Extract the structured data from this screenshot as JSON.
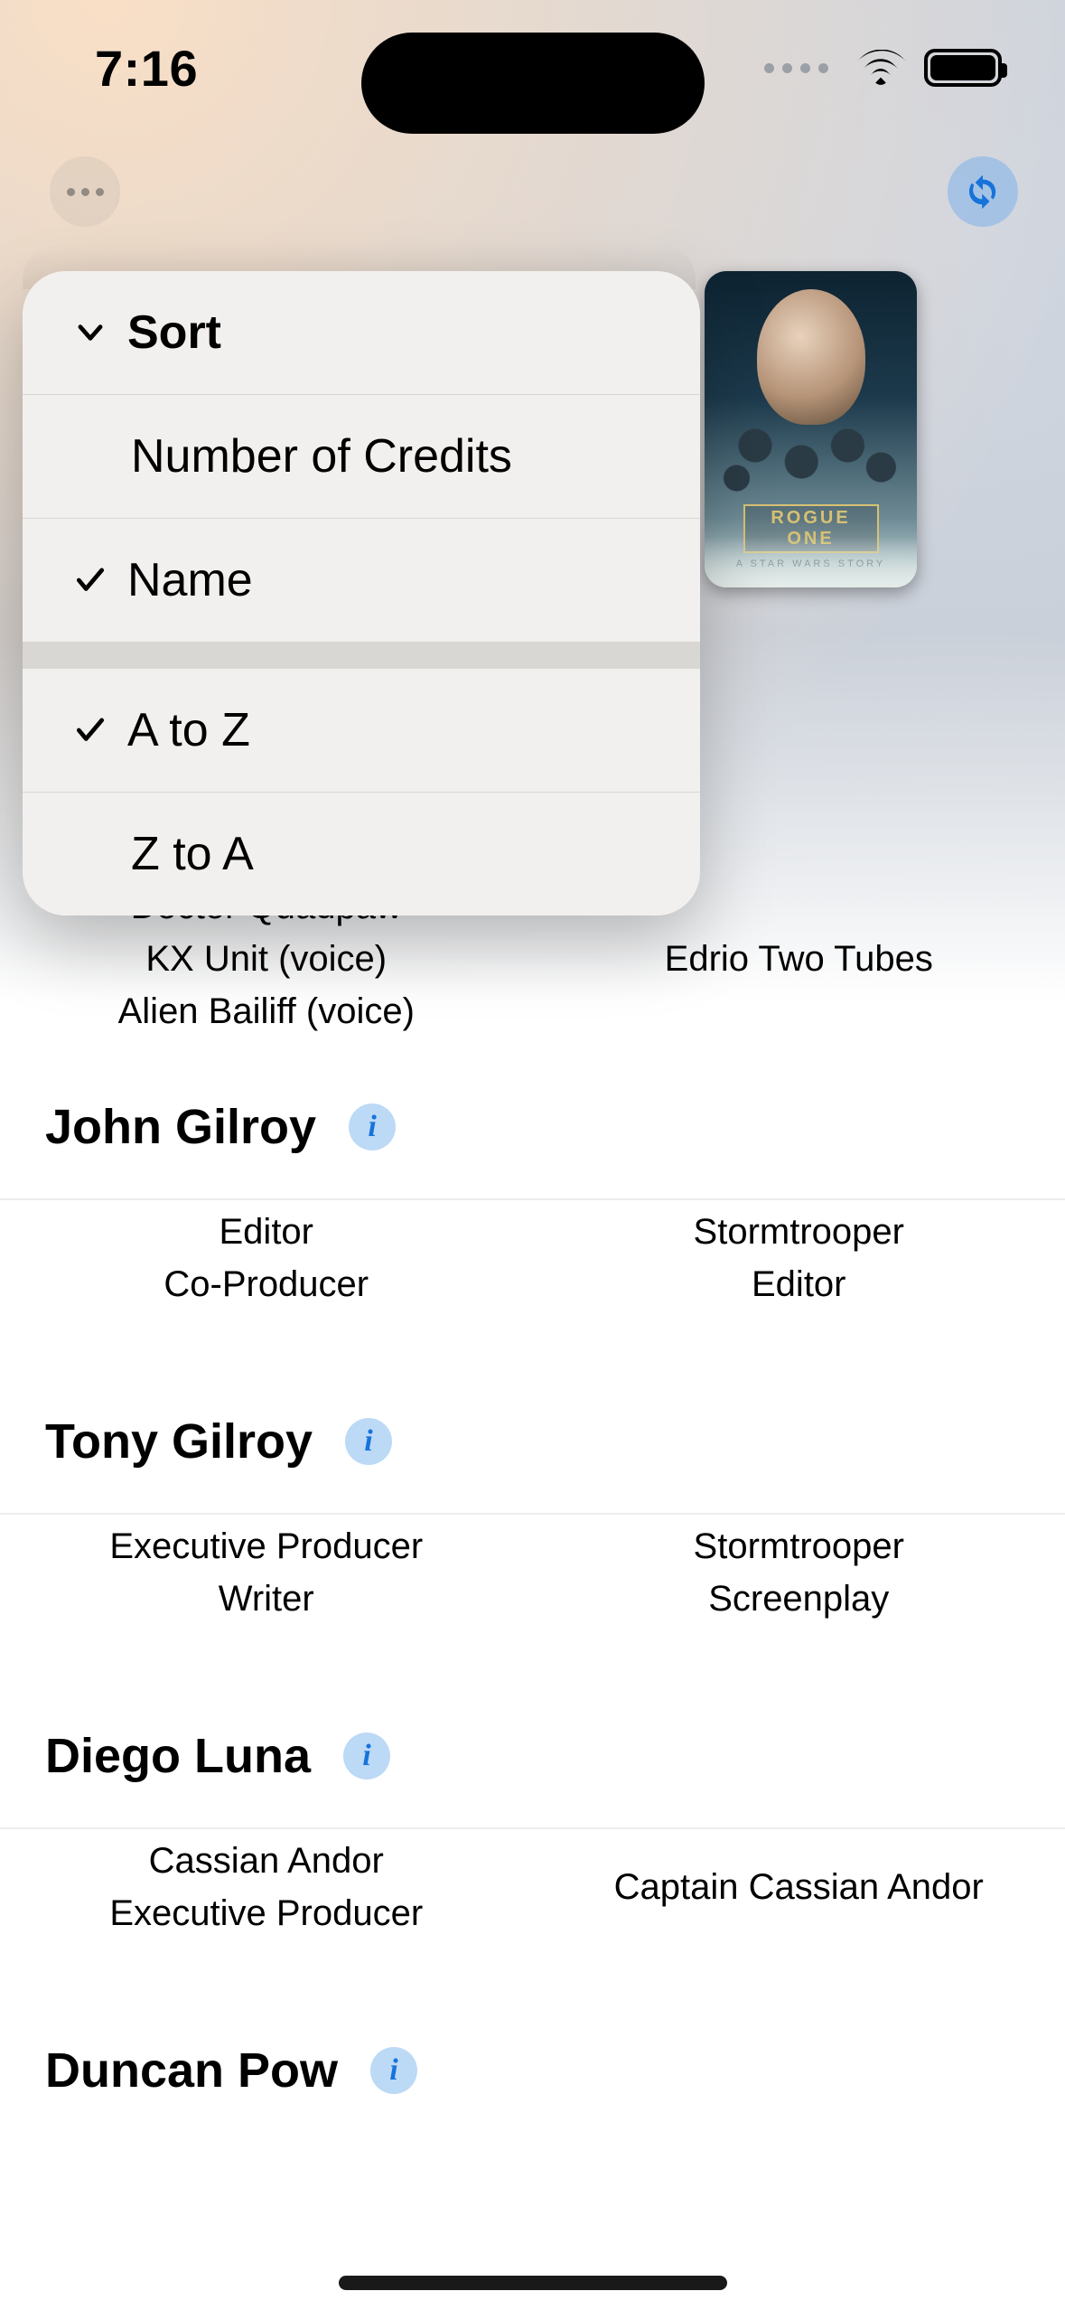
{
  "status": {
    "time": "7:16"
  },
  "poster": {
    "title": "ROGUE ONE",
    "subtitle": "A STAR WARS STORY"
  },
  "menu": {
    "header": "Sort",
    "sort_by": [
      {
        "label": "Number of Credits",
        "selected": false
      },
      {
        "label": "Name",
        "selected": true
      }
    ],
    "direction": [
      {
        "label": "A to Z",
        "selected": true
      },
      {
        "label": "Z to A",
        "selected": false
      }
    ]
  },
  "partial_roles": {
    "left": [
      "Doctor Quadpaw",
      "KX Unit (voice)",
      "Alien Bailiff (voice)"
    ],
    "right": "Edrio Two Tubes"
  },
  "people": [
    {
      "name": "John Gilroy",
      "left": [
        "Editor",
        "Co-Producer"
      ],
      "right": [
        "Stormtrooper",
        "Editor"
      ]
    },
    {
      "name": "Tony Gilroy",
      "left": [
        "Executive Producer",
        "Writer"
      ],
      "right": [
        "Stormtrooper",
        "Screenplay"
      ]
    },
    {
      "name": "Diego Luna",
      "left": [
        "Cassian Andor",
        "Executive Producer"
      ],
      "right": [
        "Captain Cassian Andor"
      ]
    },
    {
      "name": "Duncan Pow",
      "left": [],
      "right": []
    }
  ]
}
